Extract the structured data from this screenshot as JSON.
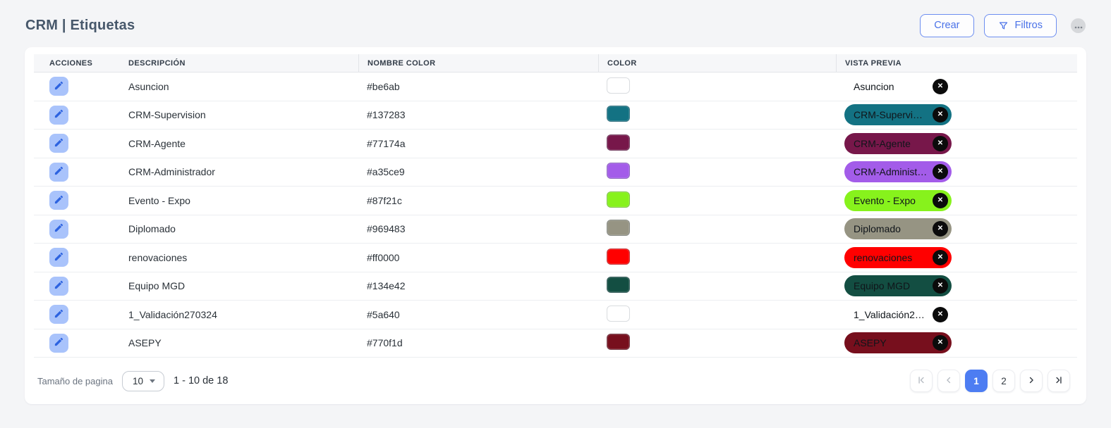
{
  "page": {
    "title": "CRM | Etiquetas"
  },
  "toolbar": {
    "create_label": "Crear",
    "filters_label": "Filtros"
  },
  "theme": {
    "accent_blue": "#4a72e8",
    "active_page_bg": "#4d7df2",
    "edit_button_bg": "#a9c3fb",
    "edit_pen_color": "#2d63e0",
    "chip_close_bg": "#0b0b0b"
  },
  "table": {
    "columns": [
      "ACCIONES",
      "DESCRIPCIÓN",
      "NOMBRE COLOR",
      "COLOR",
      "VISTA PREVIA"
    ],
    "rows": [
      {
        "description": "Asuncion",
        "color_name": "#be6ab"
      },
      {
        "description": "CRM-Supervision",
        "color_name": "#137283"
      },
      {
        "description": "CRM-Agente",
        "color_name": "#77174a"
      },
      {
        "description": "CRM-Administrador",
        "color_name": "#a35ce9"
      },
      {
        "description": "Evento - Expo",
        "color_name": "#87f21c"
      },
      {
        "description": "Diplomado",
        "color_name": "#969483"
      },
      {
        "description": "renovaciones",
        "color_name": "#ff0000"
      },
      {
        "description": "Equipo MGD",
        "color_name": "#134e42"
      },
      {
        "description": "1_Validación270324",
        "color_name": "#5a640"
      },
      {
        "description": "ASEPY",
        "color_name": "#770f1d"
      }
    ]
  },
  "footer": {
    "page_size_label": "Tamaño de pagina",
    "page_size": "10",
    "range_text": "1 - 10 de 18",
    "pages": [
      "1",
      "2"
    ],
    "current_page": "1"
  }
}
